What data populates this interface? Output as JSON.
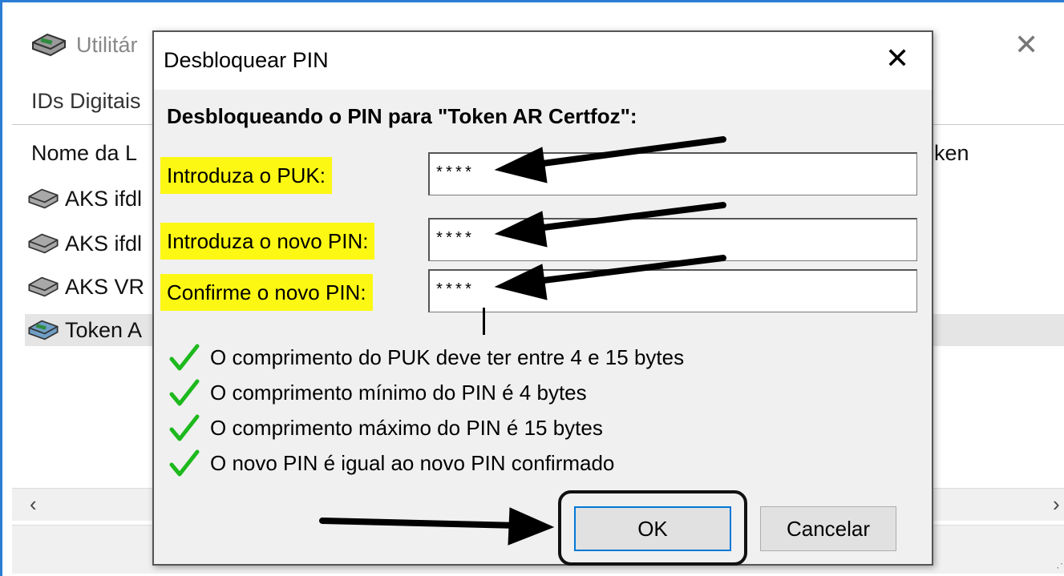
{
  "background_window": {
    "title": "Utilitár",
    "menu": "IDs Digitais",
    "column_header": "Nome da L",
    "column_header_right": "ken",
    "devices": [
      {
        "label": "AKS ifdl",
        "icon": "reader-icon"
      },
      {
        "label": "AKS ifdl",
        "icon": "reader-icon"
      },
      {
        "label": "AKS VR",
        "icon": "reader-icon"
      },
      {
        "label": "Token A",
        "icon": "token-reader-icon"
      }
    ],
    "close_glyph": "✕",
    "scroll_left": "‹",
    "scroll_right": "›"
  },
  "dialog": {
    "title": "Desbloquear PIN",
    "close_glyph": "✕",
    "heading": "Desbloqueando o PIN para \"Token AR Certfoz\":",
    "fields": {
      "puk_label": "Introduza o PUK:",
      "puk_value": "****",
      "new_pin_label": "Introduza o novo PIN:",
      "new_pin_value": "****",
      "confirm_pin_label": "Confirme o novo PIN:",
      "confirm_pin_value": "****"
    },
    "checks": [
      "O comprimento do PUK deve ter entre 4 e 15 bytes",
      "O comprimento mínimo do PIN é 4 bytes",
      "O comprimento máximo do PIN é 15 bytes",
      "O novo PIN é igual ao novo PIN confirmado"
    ],
    "ok_label": "OK",
    "cancel_label": "Cancelar"
  },
  "colors": {
    "label_highlight": "#fcf814",
    "check_green": "#1db91d",
    "window_border": "#2b7cd3",
    "ok_focus_border": "#0078d7"
  }
}
